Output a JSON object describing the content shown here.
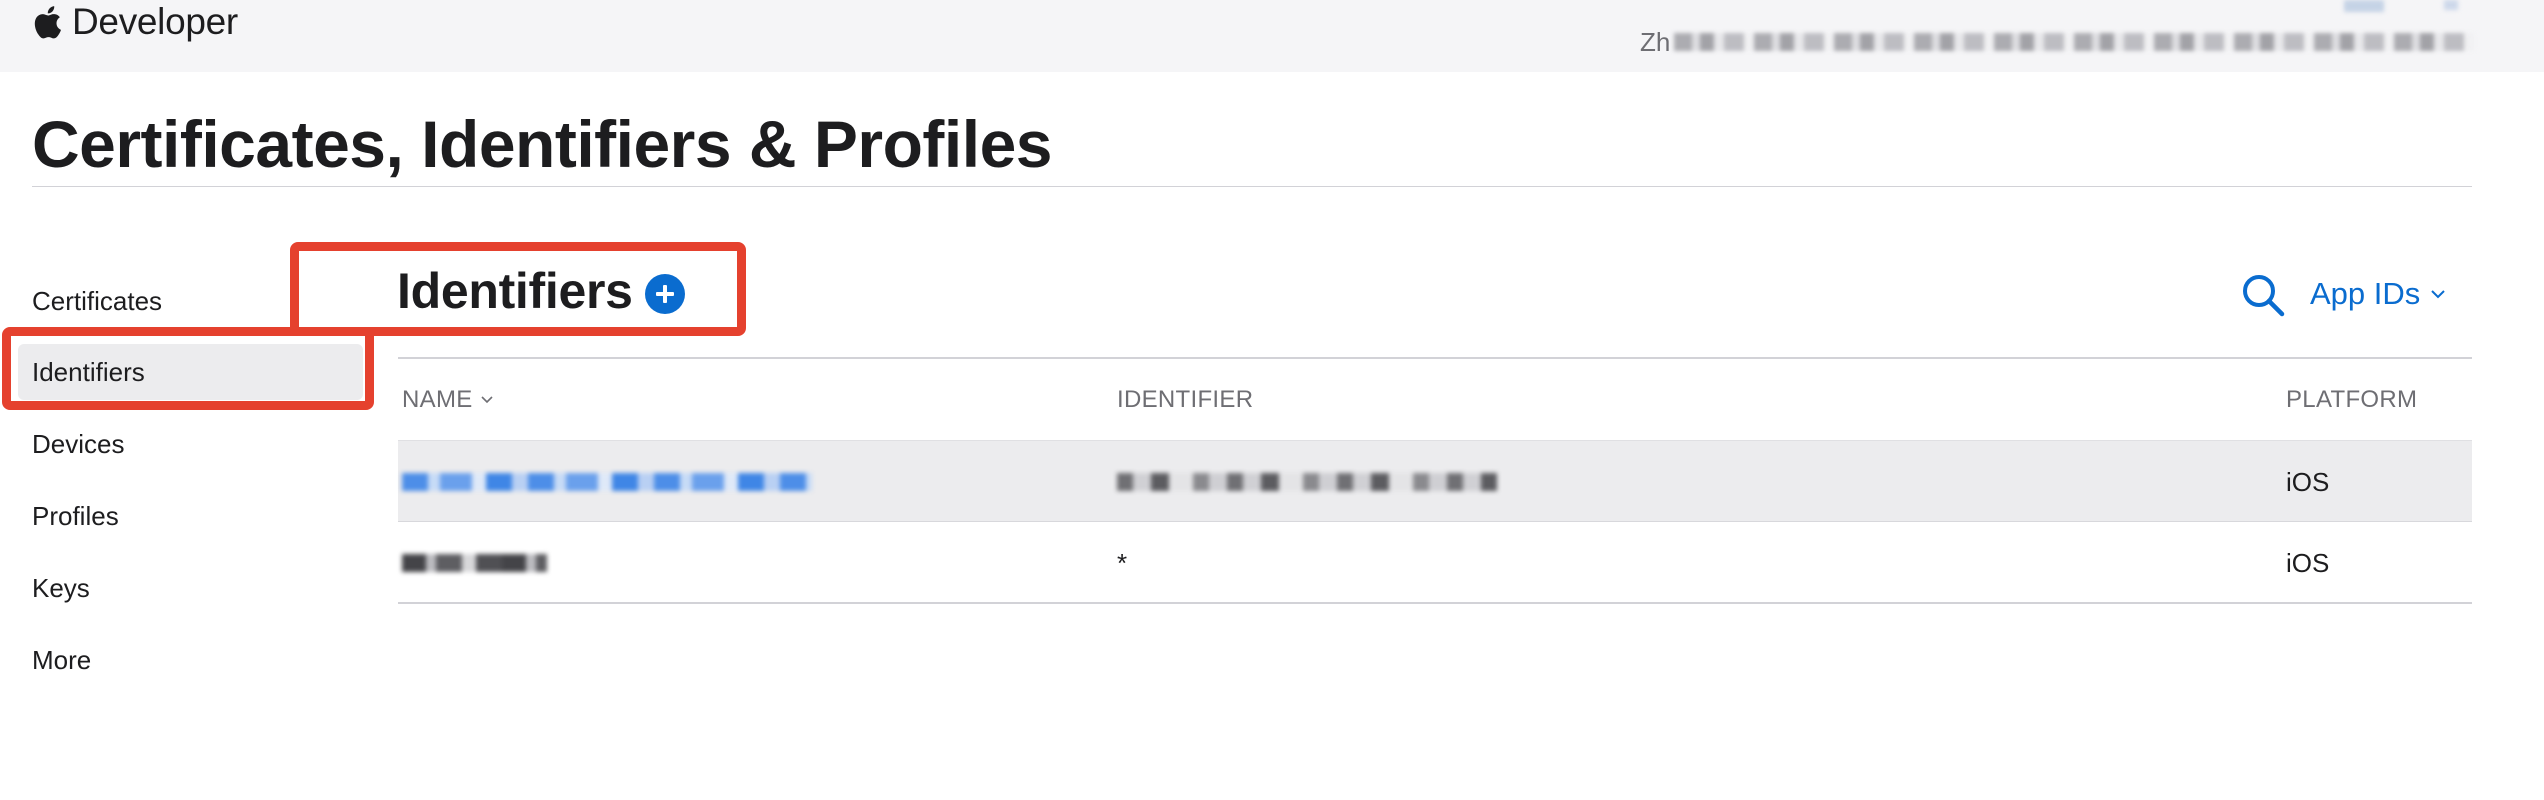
{
  "header": {
    "brand": "Developer",
    "account_initials": "Zh"
  },
  "page": {
    "title": "Certificates, Identifiers & Profiles"
  },
  "sidebar": {
    "items": [
      {
        "label": "Certificates",
        "active": false
      },
      {
        "label": "Identifiers",
        "active": true
      },
      {
        "label": "Devices",
        "active": false
      },
      {
        "label": "Profiles",
        "active": false
      },
      {
        "label": "Keys",
        "active": false
      },
      {
        "label": "More",
        "active": false
      }
    ]
  },
  "section": {
    "title": "Identifiers",
    "filter_label": "App IDs"
  },
  "table": {
    "headers": {
      "name": "NAME",
      "identifier": "IDENTIFIER",
      "platform": "PLATFORM"
    },
    "rows": [
      {
        "name": "",
        "identifier": "",
        "platform": "iOS"
      },
      {
        "name": "",
        "identifier": "*",
        "platform": "iOS"
      }
    ]
  },
  "colors": {
    "accent": "#0a6ccf",
    "highlight": "#e5412e",
    "topbar": "#f5f5f7",
    "selected_row": "#ececee"
  },
  "icons": {
    "brand": "apple-logo-icon",
    "add": "plus-circle-icon",
    "search": "search-icon",
    "sort": "chevron-down-icon",
    "filter": "chevron-down-icon"
  }
}
